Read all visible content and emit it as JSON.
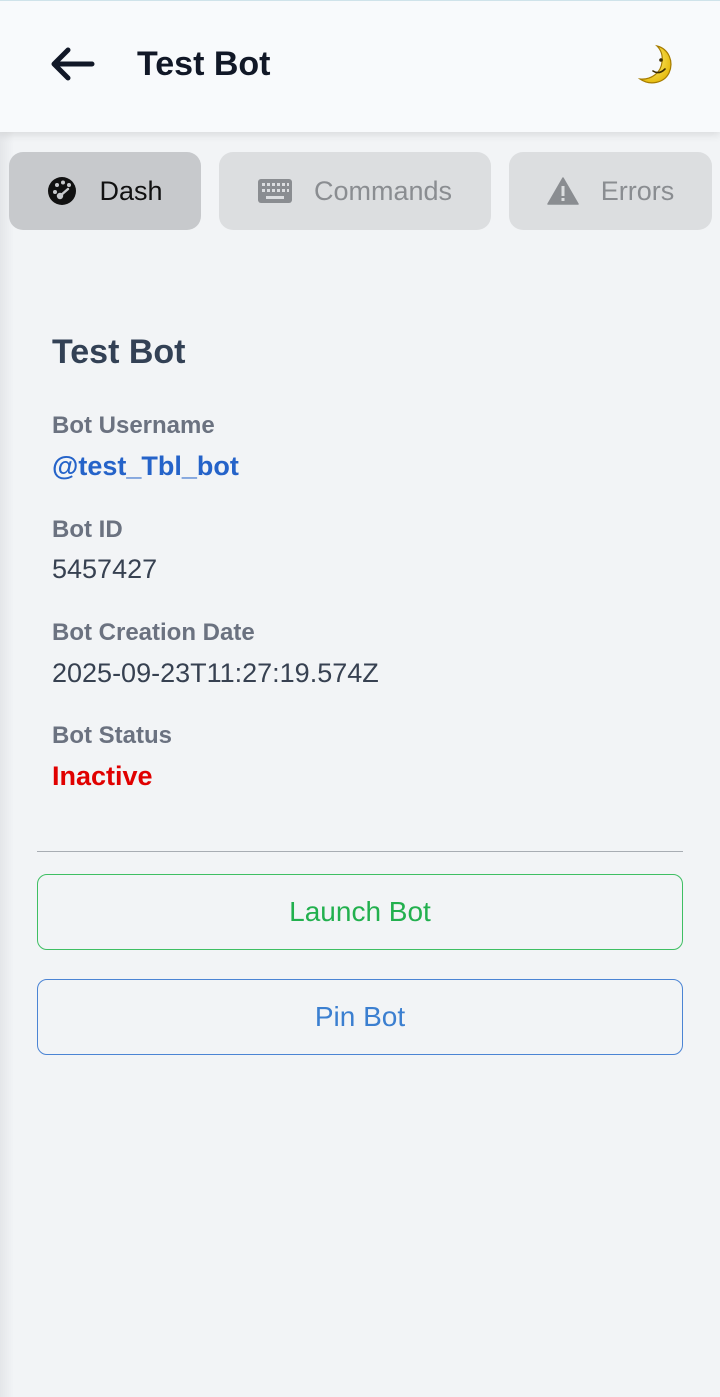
{
  "header": {
    "title": "Test Bot",
    "back_icon": "arrow-left-icon",
    "theme_icon": "crescent-moon-icon"
  },
  "tabs": [
    {
      "label": "Dash",
      "icon": "dashboard-gauge-icon",
      "active": true
    },
    {
      "label": "Commands",
      "icon": "keyboard-icon",
      "active": false
    },
    {
      "label": "Errors",
      "icon": "warning-icon",
      "active": false
    }
  ],
  "bot": {
    "name": "Test Bot",
    "username_label": "Bot Username",
    "username": "@test_Tbl_bot",
    "id_label": "Bot ID",
    "id": "5457427",
    "creation_label": "Bot Creation Date",
    "creation_date": "2025-09-23T11:27:19.574Z",
    "status_label": "Bot Status",
    "status": "Inactive"
  },
  "actions": {
    "launch_label": "Launch Bot",
    "pin_label": "Pin Bot"
  },
  "colors": {
    "status_inactive": "#e00000",
    "link": "#2563c9",
    "launch": "#22b04e",
    "pin": "#3b7fd0"
  }
}
